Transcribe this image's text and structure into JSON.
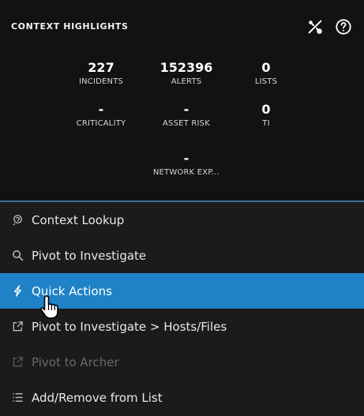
{
  "header": {
    "title": "CONTEXT HIGHLIGHTS",
    "tools": {
      "settings_icon": "tools-icon",
      "help_icon": "help-icon"
    }
  },
  "stats": [
    {
      "value": "227",
      "label": "INCIDENTS"
    },
    {
      "value": "152396",
      "label": "ALERTS"
    },
    {
      "value": "0",
      "label": "LISTS"
    },
    {
      "value": "-",
      "label": "CRITICALITY"
    },
    {
      "value": "-",
      "label": "ASSET RISK"
    },
    {
      "value": "0",
      "label": "TI"
    },
    {
      "value": "-",
      "label": "NETWORK EXP..."
    }
  ],
  "menu": {
    "items": [
      {
        "label": "Context Lookup",
        "icon": "context-lookup-icon",
        "state": "normal"
      },
      {
        "label": "Pivot to Investigate",
        "icon": "search-icon",
        "state": "normal"
      },
      {
        "label": "Quick Actions",
        "icon": "lightning-icon",
        "state": "active"
      },
      {
        "label": "Pivot to Investigate > Hosts/Files",
        "icon": "external-link-icon",
        "state": "normal"
      },
      {
        "label": "Pivot to Archer",
        "icon": "external-link-icon",
        "state": "disabled"
      },
      {
        "label": "Add/Remove from List",
        "icon": "list-icon",
        "state": "normal"
      }
    ]
  },
  "colors": {
    "panel_bg": "#1b1b1b",
    "header_bg": "#121212",
    "active_bg": "#1f82c7",
    "divider": "#3e6f99"
  }
}
